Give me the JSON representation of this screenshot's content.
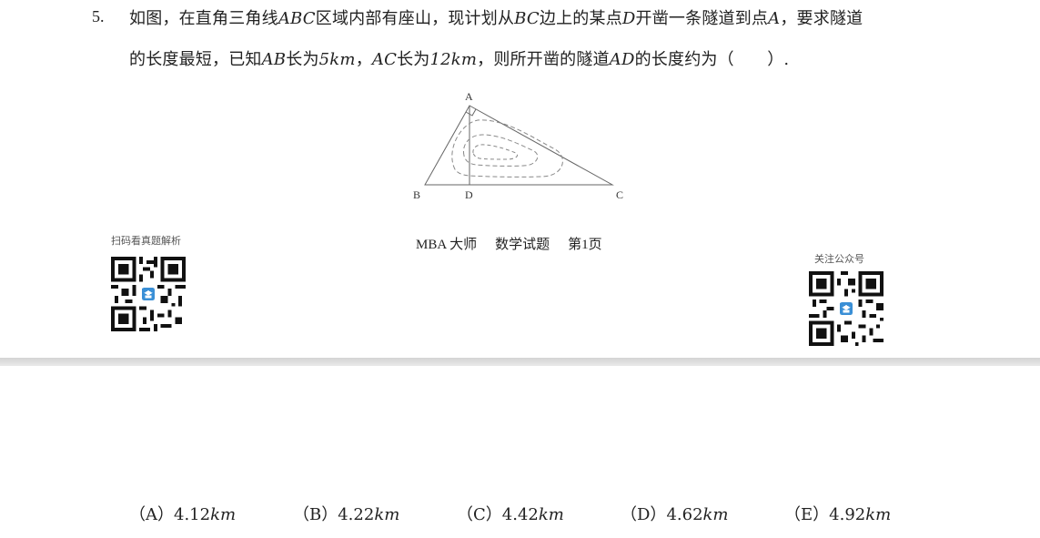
{
  "question": {
    "number": "5.",
    "line1_parts": [
      "如图，在直角三角线",
      "ABC",
      "区域内部有座山，现计划从",
      "BC",
      "边上的某点",
      "D",
      "开凿一条隧道到点",
      "A",
      "，要求隧道"
    ],
    "line2_parts": [
      "的长度最短，已知",
      "AB",
      "长为",
      "5km",
      "，",
      "AC",
      "长为",
      "12km",
      "，则所开凿的隧道",
      "AD",
      "的长度约为（　　）."
    ]
  },
  "figure": {
    "label_a": "A",
    "label_b": "B",
    "label_c": "C",
    "label_d": "D"
  },
  "footer": {
    "brand": "MBA 大师",
    "subject": "数学试题",
    "page": "第1页"
  },
  "qr_left": {
    "label": "扫码看真题解析",
    "icon": "qr-code-icon"
  },
  "qr_right": {
    "label": "关注公众号",
    "icon": "qr-code-icon"
  },
  "options": [
    {
      "letter": "（A）",
      "value": "4.12",
      "unit": "km"
    },
    {
      "letter": "（B）",
      "value": "4.22",
      "unit": "km"
    },
    {
      "letter": "（C）",
      "value": "4.42",
      "unit": "km"
    },
    {
      "letter": "（D）",
      "value": "4.62",
      "unit": "km"
    },
    {
      "letter": "（E）",
      "value": "4.92",
      "unit": "km"
    }
  ]
}
